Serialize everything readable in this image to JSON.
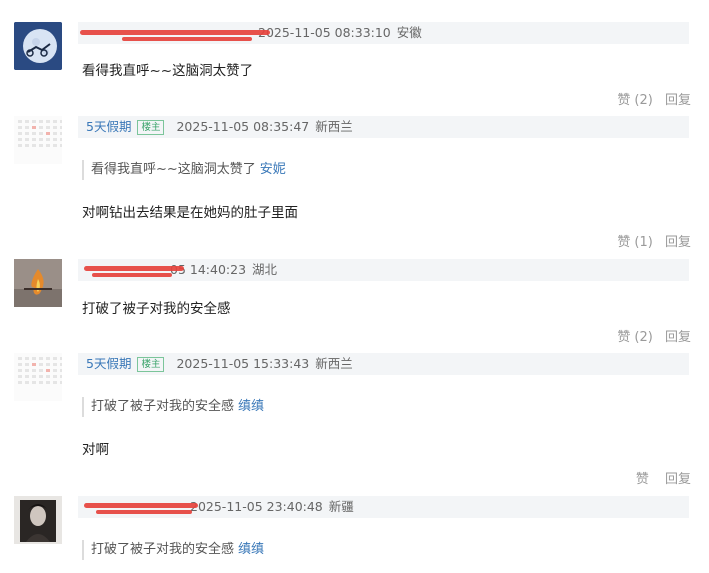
{
  "comments": [
    {
      "username": "",
      "time": "2025-11-05 08:33:10",
      "region": "安徽",
      "text": "看得我直呼~~这脑洞太赞了",
      "like_label": "赞",
      "like_count": "(2)",
      "reply_label": "回复",
      "avatar_icon": "moon-bicycle-avatar-icon"
    },
    {
      "username": "5天假期",
      "badge": "楼主",
      "time": "2025-11-05 08:35:47",
      "region": "新西兰",
      "quote_text": "看得我直呼~~这脑洞太赞了",
      "quote_author": "安妮",
      "text": "对啊钻出去结果是在她妈的肚子里面",
      "like_label": "赞",
      "like_count": "(1)",
      "reply_label": "回复",
      "avatar_icon": "calendar-avatar-icon"
    },
    {
      "username": "",
      "time": "05 14:40:23",
      "region": "湖北",
      "text": "打破了被子对我的安全感",
      "like_label": "赞",
      "like_count": "(2)",
      "reply_label": "回复",
      "avatar_icon": "flame-avatar-icon"
    },
    {
      "username": "5天假期",
      "badge": "楼主",
      "time": "2025-11-05 15:33:43",
      "region": "新西兰",
      "quote_text": "打破了被子对我的安全感",
      "quote_author": "缜缜",
      "text": "对啊",
      "like_label": "赞",
      "like_count": "",
      "reply_label": "回复",
      "avatar_icon": "calendar-avatar-icon"
    },
    {
      "username": "",
      "time": "2025-11-05 23:40:48",
      "region": "新疆",
      "quote_text": "打破了被子对我的安全感",
      "quote_author": "缜缜",
      "avatar_icon": "portrait-avatar-icon"
    }
  ],
  "colors": {
    "link": "#3a78b8",
    "badge": "#3aa36a",
    "redaction": "#e6423c",
    "meta_bar": "#f3f5f7"
  }
}
